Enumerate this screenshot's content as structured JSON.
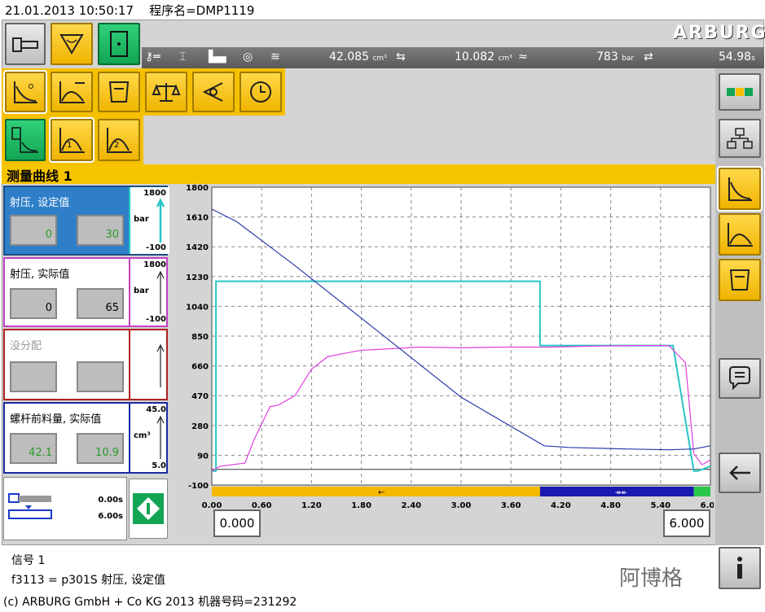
{
  "header": {
    "datetime": "21.01.2013 10:50:17",
    "program": "程序名=DMP1119"
  },
  "logo": "ARBURG",
  "stats": [
    {
      "value": "42.085",
      "unit": "cm³"
    },
    {
      "value": "10.082",
      "unit": "cm³"
    },
    {
      "value": "783",
      "unit": "bar"
    },
    {
      "value": "54.98",
      "unit": "s"
    }
  ],
  "screen_title": "测量曲线 1",
  "panels": [
    {
      "label": "射压, 设定值",
      "v1": "0",
      "v2": "30",
      "max": "1800",
      "unit": "bar",
      "min": "-100",
      "color": "#29c4c4"
    },
    {
      "label": "射压, 实际值",
      "v1": "0",
      "v2": "65",
      "max": "1800",
      "unit": "bar",
      "min": "-100",
      "color": "#d040d0"
    },
    {
      "label": "没分配",
      "v1": "",
      "v2": "",
      "max": "",
      "unit": "",
      "min": "",
      "color": "#b02020"
    },
    {
      "label": "螺杆前料量, 实际值",
      "v1": "42.1",
      "v2": "10.9",
      "max": "45.0",
      "unit": "cm³",
      "min": "5.0",
      "color": "#1a2aa0"
    }
  ],
  "timing": {
    "t1": "0.00s",
    "t2": "6.00s"
  },
  "range": {
    "start": "0.000",
    "end": "6.000"
  },
  "status": {
    "line1": "信号 1",
    "line2": "f3113 = p301S 射压, 设定值"
  },
  "footer": "(c) ARBURG GmbH + Co KG 2013    机器号码=231292",
  "watermark": "阿博格",
  "colors": {
    "accent": "#f5c000",
    "green": "#14a554",
    "plot_cyan": "#29c4c4",
    "plot_magenta": "#e040e0",
    "plot_blue": "#2a3aa8"
  },
  "chart_data": {
    "type": "line",
    "x_ticks": [
      "0.00",
      "0.60",
      "1.20",
      "1.80",
      "2.40",
      "3.00",
      "3.60",
      "4.20",
      "4.80",
      "5.40",
      "6.00"
    ],
    "y_ticks": [
      "1800",
      "1610",
      "1420",
      "1230",
      "1040",
      "850",
      "660",
      "470",
      "280",
      "90",
      "-100"
    ],
    "xlim": [
      0,
      6
    ],
    "ylim": [
      -100,
      1800
    ],
    "grid": true,
    "series": [
      {
        "name": "射压, 设定值",
        "color": "#29c4c4",
        "x": [
          0.0,
          0.05,
          0.05,
          3.95,
          3.95,
          5.55,
          5.8,
          5.85,
          6.0
        ],
        "y": [
          -10,
          -10,
          1200,
          1200,
          790,
          790,
          -10,
          -10,
          20
        ]
      },
      {
        "name": "射压, 实际值",
        "color": "#e040e0",
        "x": [
          0.0,
          0.1,
          0.4,
          0.5,
          0.7,
          0.8,
          1.0,
          1.2,
          1.4,
          1.6,
          1.8,
          2.0,
          2.5,
          3.0,
          3.5,
          3.95,
          4.1,
          4.5,
          5.0,
          5.5,
          5.7,
          5.8,
          5.9,
          6.0
        ],
        "y": [
          -10,
          20,
          40,
          180,
          400,
          410,
          470,
          640,
          720,
          740,
          760,
          765,
          780,
          775,
          780,
          780,
          780,
          785,
          790,
          790,
          680,
          100,
          30,
          60
        ]
      },
      {
        "name": "螺杆前料量, 实际值",
        "color": "#2a3aa8",
        "x": [
          0.0,
          0.3,
          1.0,
          2.0,
          3.0,
          4.0,
          4.3,
          5.0,
          5.5,
          5.8,
          6.0
        ],
        "y": [
          1660,
          1580,
          1300,
          880,
          460,
          150,
          140,
          130,
          125,
          130,
          150
        ]
      }
    ]
  }
}
